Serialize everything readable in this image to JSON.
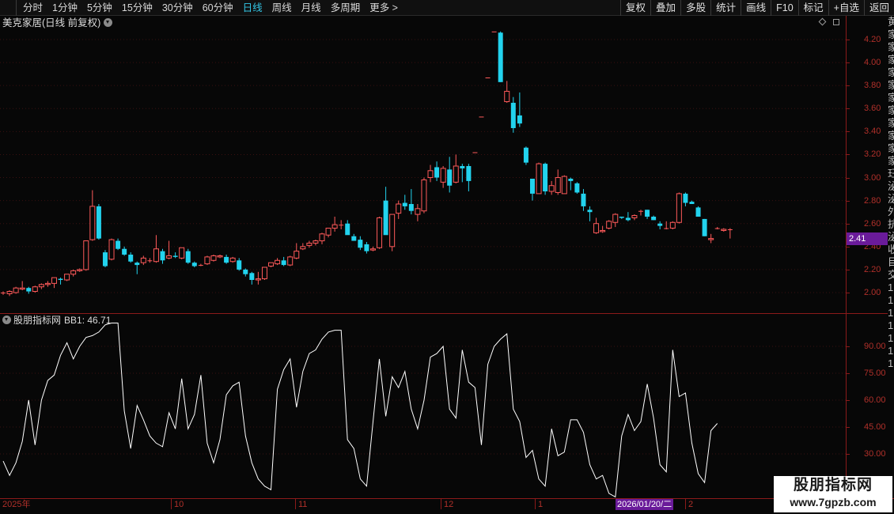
{
  "toolbar": {
    "periods": [
      "分时",
      "1分钟",
      "5分钟",
      "15分钟",
      "30分钟",
      "60分钟",
      "日线",
      "周线",
      "月线",
      "多周期",
      "更多 >"
    ],
    "active_period": "日线",
    "tools": [
      "复权",
      "叠加",
      "多股",
      "统计",
      "画线",
      "F10",
      "标记",
      "+自选",
      "返回"
    ]
  },
  "main_chart": {
    "title": "美克家居(日线 前复权)",
    "y_ticks": [
      "4.20",
      "4.00",
      "3.80",
      "3.60",
      "3.40",
      "3.20",
      "3.00",
      "2.80",
      "2.60",
      "2.40",
      "2.20",
      "2.00"
    ],
    "last_price_tag": "2.41"
  },
  "indicator": {
    "name": "股朋指标网",
    "value_label": "BB1: 46.71",
    "y_ticks": [
      "90.00",
      "75.00",
      "60.00",
      "45.00",
      "30.00"
    ]
  },
  "date_axis": {
    "labels": [
      "2025年",
      "10",
      "11",
      "12",
      "1",
      "2"
    ],
    "cursor_date": "2026/01/20/二"
  },
  "watermark": {
    "title": "股朋指标网",
    "url": "www.7gpzb.com"
  },
  "colors": {
    "up": "#ff5a5a",
    "down": "#22d3ee",
    "indicator_line": "#ffffff",
    "axis": "#8b1a1a",
    "active_tab": "#33c6e6",
    "price_tag": "#6a1b9a"
  },
  "chart_data": [
    {
      "type": "candlestick",
      "title": "美克家居(日线 前复权)",
      "ylim": [
        1.85,
        4.35
      ],
      "ohlc": [
        [
          2.0,
          2.01,
          1.98,
          2.0
        ],
        [
          1.99,
          2.02,
          1.97,
          2.01
        ],
        [
          2.0,
          2.05,
          1.99,
          2.04
        ],
        [
          2.03,
          2.1,
          2.02,
          2.04
        ],
        [
          2.04,
          2.05,
          1.99,
          2.01
        ],
        [
          2.01,
          2.06,
          2.0,
          2.05
        ],
        [
          2.05,
          2.08,
          2.03,
          2.07
        ],
        [
          2.07,
          2.1,
          2.05,
          2.08
        ],
        [
          2.08,
          2.13,
          2.04,
          2.13
        ],
        [
          2.12,
          2.13,
          2.07,
          2.11
        ],
        [
          2.11,
          2.16,
          2.1,
          2.16
        ],
        [
          2.16,
          2.2,
          2.14,
          2.19
        ],
        [
          2.19,
          2.21,
          2.18,
          2.2
        ],
        [
          2.2,
          2.45,
          2.19,
          2.45
        ],
        [
          2.46,
          2.89,
          2.45,
          2.75
        ],
        [
          2.75,
          2.77,
          2.46,
          2.47
        ],
        [
          2.35,
          2.37,
          2.22,
          2.23
        ],
        [
          2.29,
          2.47,
          2.28,
          2.46
        ],
        [
          2.45,
          2.47,
          2.37,
          2.38
        ],
        [
          2.38,
          2.4,
          2.32,
          2.33
        ],
        [
          2.33,
          2.35,
          2.26,
          2.27
        ],
        [
          2.26,
          2.27,
          2.16,
          2.24
        ],
        [
          2.26,
          2.32,
          2.24,
          2.3
        ],
        [
          2.28,
          2.3,
          2.26,
          2.28
        ],
        [
          2.27,
          2.5,
          2.26,
          2.38
        ],
        [
          2.36,
          2.38,
          2.25,
          2.28
        ],
        [
          2.3,
          2.45,
          2.29,
          2.32
        ],
        [
          2.32,
          2.35,
          2.3,
          2.31
        ],
        [
          2.3,
          2.39,
          2.29,
          2.39
        ],
        [
          2.36,
          2.38,
          2.25,
          2.26
        ],
        [
          2.26,
          2.27,
          2.22,
          2.23
        ],
        [
          2.24,
          2.25,
          2.23,
          2.24
        ],
        [
          2.25,
          2.32,
          2.24,
          2.31
        ],
        [
          2.28,
          2.33,
          2.27,
          2.32
        ],
        [
          2.31,
          2.33,
          2.3,
          2.32
        ],
        [
          2.31,
          2.33,
          2.25,
          2.26
        ],
        [
          2.27,
          2.31,
          2.26,
          2.3
        ],
        [
          2.28,
          2.3,
          2.19,
          2.2
        ],
        [
          2.2,
          2.21,
          2.14,
          2.16
        ],
        [
          2.17,
          2.18,
          2.07,
          2.11
        ],
        [
          2.11,
          2.18,
          2.07,
          2.12
        ],
        [
          2.12,
          2.22,
          2.11,
          2.22
        ],
        [
          2.23,
          2.26,
          2.22,
          2.26
        ],
        [
          2.25,
          2.3,
          2.24,
          2.28
        ],
        [
          2.28,
          2.31,
          2.23,
          2.24
        ],
        [
          2.24,
          2.32,
          2.23,
          2.31
        ],
        [
          2.3,
          2.43,
          2.29,
          2.36
        ],
        [
          2.38,
          2.43,
          2.37,
          2.4
        ],
        [
          2.41,
          2.45,
          2.39,
          2.43
        ],
        [
          2.43,
          2.46,
          2.41,
          2.45
        ],
        [
          2.45,
          2.52,
          2.42,
          2.51
        ],
        [
          2.5,
          2.56,
          2.48,
          2.56
        ],
        [
          2.56,
          2.66,
          2.53,
          2.59
        ],
        [
          2.59,
          2.63,
          2.55,
          2.59
        ],
        [
          2.6,
          2.63,
          2.51,
          2.5
        ],
        [
          2.49,
          2.51,
          2.45,
          2.45
        ],
        [
          2.46,
          2.49,
          2.37,
          2.39
        ],
        [
          2.42,
          2.44,
          2.34,
          2.36
        ],
        [
          2.37,
          2.4,
          2.36,
          2.38
        ],
        [
          2.39,
          2.66,
          2.38,
          2.65
        ],
        [
          2.8,
          2.92,
          2.57,
          2.5
        ],
        [
          2.4,
          2.68,
          2.36,
          2.68
        ],
        [
          2.69,
          2.8,
          2.64,
          2.77
        ],
        [
          2.78,
          2.85,
          2.72,
          2.75
        ],
        [
          2.77,
          2.9,
          2.68,
          2.71
        ],
        [
          2.68,
          2.77,
          2.62,
          2.73
        ],
        [
          2.71,
          3.0,
          2.69,
          2.98
        ],
        [
          3.0,
          3.11,
          2.96,
          3.06
        ],
        [
          3.09,
          3.14,
          2.97,
          3.0
        ],
        [
          2.96,
          3.1,
          2.91,
          3.08
        ],
        [
          3.07,
          3.18,
          2.87,
          2.93
        ],
        [
          2.96,
          3.2,
          2.95,
          3.1
        ],
        [
          3.1,
          3.12,
          2.96,
          3.08
        ],
        [
          3.1,
          3.12,
          2.88,
          2.97
        ],
        [
          3.22,
          3.22,
          3.22,
          3.22
        ],
        [
          3.53,
          3.53,
          3.53,
          3.53
        ],
        [
          3.87,
          3.87,
          3.87,
          3.87
        ],
        [
          4.27,
          4.27,
          4.27,
          4.27
        ],
        [
          4.26,
          4.27,
          3.83,
          3.83
        ],
        [
          3.66,
          3.84,
          3.65,
          3.75
        ],
        [
          3.65,
          3.7,
          3.39,
          3.43
        ],
        [
          3.54,
          3.74,
          3.44,
          3.47
        ],
        [
          3.26,
          3.27,
          3.11,
          3.13
        ],
        [
          2.99,
          2.97,
          2.8,
          2.86
        ],
        [
          2.86,
          3.13,
          2.86,
          3.12
        ],
        [
          3.12,
          3.13,
          2.85,
          2.88
        ],
        [
          2.88,
          2.97,
          2.85,
          2.93
        ],
        [
          2.87,
          3.07,
          2.85,
          3.0
        ],
        [
          2.86,
          3.02,
          2.86,
          3.01
        ],
        [
          2.99,
          3.0,
          2.89,
          2.97
        ],
        [
          2.95,
          2.96,
          2.86,
          2.87
        ],
        [
          2.86,
          2.9,
          2.71,
          2.75
        ],
        [
          2.72,
          2.75,
          2.62,
          2.7
        ],
        [
          2.52,
          2.65,
          2.51,
          2.6
        ],
        [
          2.53,
          2.58,
          2.52,
          2.54
        ],
        [
          2.56,
          2.63,
          2.55,
          2.62
        ],
        [
          2.61,
          2.69,
          2.57,
          2.68
        ],
        [
          2.66,
          2.66,
          2.64,
          2.65
        ],
        [
          2.65,
          2.7,
          2.62,
          2.63
        ],
        [
          2.65,
          2.68,
          2.63,
          2.67
        ],
        [
          2.71,
          2.72,
          2.67,
          2.71
        ],
        [
          2.72,
          2.72,
          2.64,
          2.66
        ],
        [
          2.66,
          2.67,
          2.63,
          2.63
        ],
        [
          2.6,
          2.62,
          2.55,
          2.58
        ],
        [
          2.56,
          2.62,
          2.55,
          2.56
        ],
        [
          2.56,
          2.62,
          2.55,
          2.61
        ],
        [
          2.61,
          2.87,
          2.6,
          2.86
        ],
        [
          2.86,
          2.87,
          2.75,
          2.78
        ],
        [
          2.79,
          2.8,
          2.77,
          2.77
        ],
        [
          2.74,
          2.75,
          2.66,
          2.66
        ],
        [
          2.64,
          2.64,
          2.49,
          2.49
        ],
        [
          2.46,
          2.51,
          2.43,
          2.47
        ],
        [
          2.56,
          2.57,
          2.55,
          2.56
        ],
        [
          2.54,
          2.56,
          2.53,
          2.55
        ],
        [
          2.55,
          2.56,
          2.47,
          2.55
        ]
      ]
    },
    {
      "type": "line",
      "series": [
        {
          "name": "BB1",
          "values": [
            26,
            18,
            25,
            37,
            60,
            35,
            60,
            71,
            74,
            85,
            92,
            83,
            90,
            95,
            96,
            98,
            102,
            103,
            103,
            54,
            33,
            57,
            49,
            40,
            36,
            34,
            53,
            44,
            72,
            44,
            52,
            74,
            36,
            25,
            38,
            63,
            68,
            70,
            40,
            25,
            16,
            12,
            10,
            66,
            77,
            83,
            56,
            76,
            86,
            88,
            94,
            98,
            99,
            99,
            38,
            33,
            16,
            12,
            48,
            83,
            51,
            73,
            67,
            76,
            55,
            44,
            60,
            84,
            86,
            90,
            55,
            50,
            88,
            70,
            67,
            35,
            80,
            90,
            94,
            97,
            55,
            48,
            28,
            32,
            16,
            12,
            44,
            29,
            31,
            49,
            49,
            42,
            24,
            16,
            18,
            8,
            6,
            40,
            52,
            43,
            48,
            69,
            50,
            24,
            20,
            88,
            62,
            64,
            36,
            19,
            14,
            43,
            47
          ]
        }
      ],
      "ylim": [
        0,
        105
      ]
    }
  ]
}
